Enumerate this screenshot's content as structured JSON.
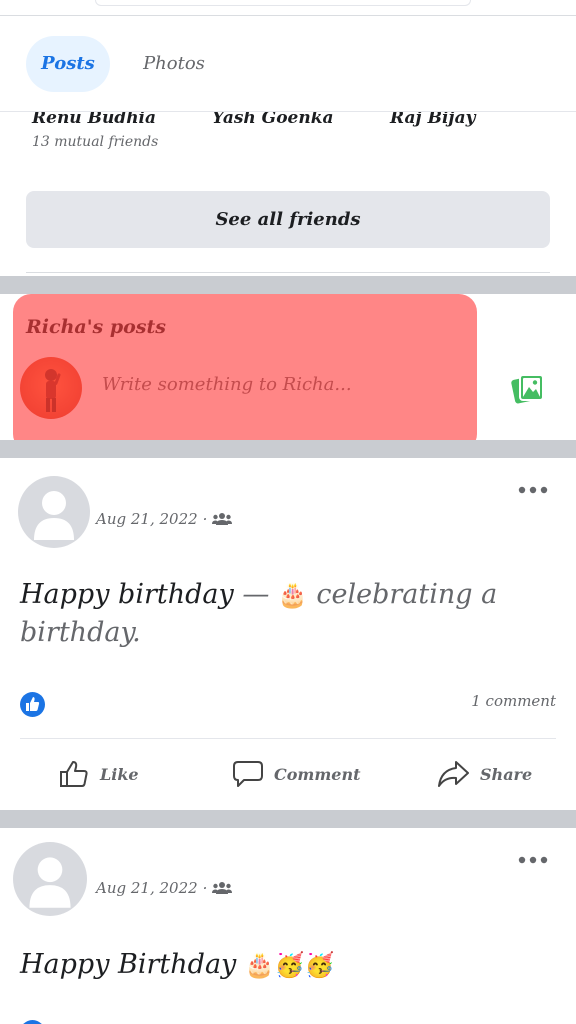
{
  "tabs": [
    {
      "label": "Posts",
      "active": true
    },
    {
      "label": "Photos",
      "active": false
    }
  ],
  "friends": {
    "names": [
      "Renu Budhia",
      "Yash Goenka",
      "Raj Bijay"
    ],
    "mutual_text": "13 mutual friends",
    "see_all_label": "See all friends"
  },
  "composer": {
    "title": "Richa's posts",
    "placeholder": "Write something to Richa...",
    "photo_icon": "photo-icon",
    "highlight_color": "#ff3c3c"
  },
  "posts": [
    {
      "date": "Aug 21, 2022",
      "audience_icon": "friends-icon",
      "text_main": "Happy birthday",
      "text_dash": " — ",
      "text_emoji": "🎂",
      "text_rest": " celebrating a birthday.",
      "reaction_icon": "like-icon",
      "comment_count": "1 comment",
      "actions": {
        "like": "Like",
        "comment": "Comment",
        "share": "Share"
      }
    },
    {
      "date": "Aug 21, 2022",
      "audience_icon": "friends-icon",
      "text_main": "Happy Birthday",
      "text_emoji": "🎂🥳🥳"
    }
  ],
  "colors": {
    "accent": "#1b74e4",
    "tab_active_bg": "#e7f3ff",
    "separator": "#c9ccd1",
    "photo_green": "#45bd62"
  }
}
